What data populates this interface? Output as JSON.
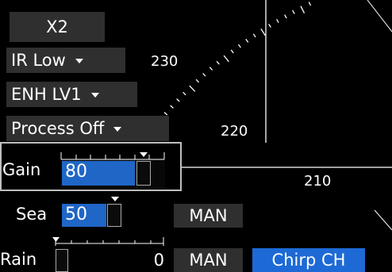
{
  "zoom_button": "X2",
  "ir_dropdown": "IR Low",
  "enh_dropdown": "ENH LV1",
  "process_dropdown": "Process Off",
  "range_labels": [
    "230",
    "220",
    "210"
  ],
  "gain": {
    "label": "Gain",
    "value": "80"
  },
  "sea": {
    "label": "Sea",
    "value": "50",
    "mode": "MAN"
  },
  "rain": {
    "label": "Rain",
    "value": "0",
    "mode": "MAN"
  },
  "chirp_button": "Chirp CH"
}
